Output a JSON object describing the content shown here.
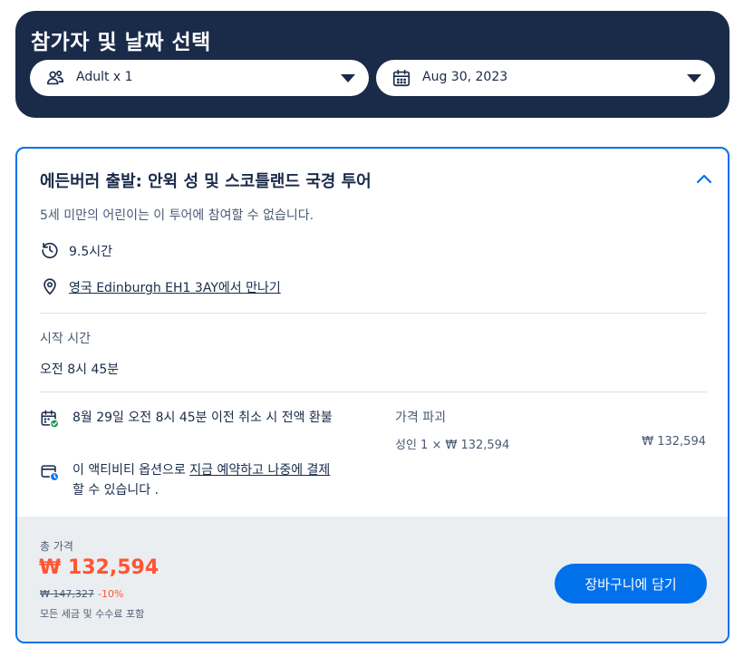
{
  "header": {
    "title": "참가자 및 날짜 선택",
    "participants": {
      "value": "Adult x 1",
      "icon": "participants-icon"
    },
    "date": {
      "value": "Aug 30, 2023",
      "icon": "calendar-icon"
    }
  },
  "tour": {
    "title": "에든버러 출발: 안윅 성 및 스코틀랜드 국경 투어",
    "age_note": "5세 미만의 어린이는 이 투어에 참여할 수 없습니다.",
    "duration": "9.5시간",
    "meeting_point": "영국 Edinburgh EH1 3AY에서 만나기",
    "start_time_label": "시작 시간",
    "start_time": "오전 8시 45분",
    "cancellation": "8월 29일 오전 8시 45분 이전 취소 시 전액 환불",
    "pay_later": {
      "prefix": "이 액티비티 옵션으로 ",
      "link": "지금 예약하고 나중에 결제",
      "suffix": " 할 수 있습니다 ."
    },
    "breakdown": {
      "title": "가격 파괴",
      "line": "성인 1 × ₩ 132,594",
      "amount": "₩ 132,594"
    }
  },
  "footer": {
    "total_label": "총 가격",
    "total_price": "₩ 132,594",
    "original_price": "₩ 147,327",
    "discount": "-10%",
    "tax_note": "모든 세금 및 수수료 포함",
    "cart_button": "장바구니에 담기"
  },
  "colors": {
    "navy": "#1a2b49",
    "accent_blue": "#0071eb",
    "price_orange": "#ff5533",
    "footer_bg": "#ebeef1"
  }
}
